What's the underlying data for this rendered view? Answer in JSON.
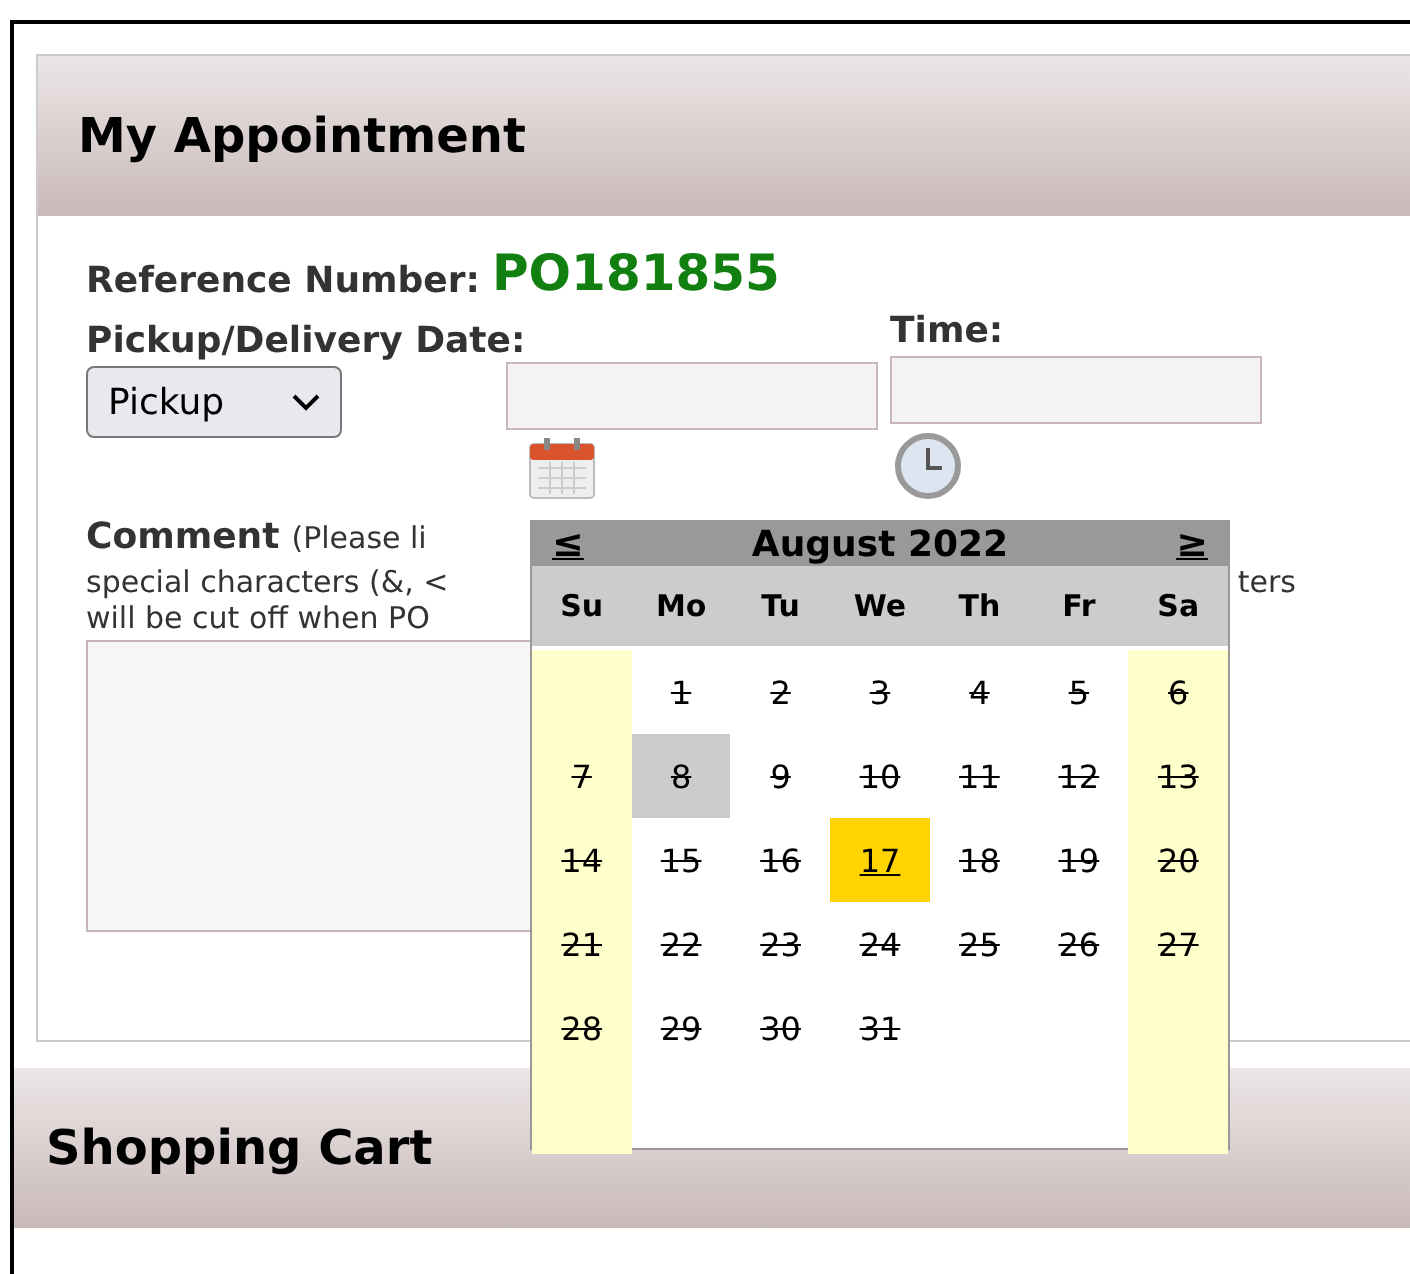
{
  "appointment": {
    "title": "My Appointment",
    "reference_label": "Reference Number:",
    "reference_number": "PO181855",
    "date_label": "Pickup/Delivery Date:",
    "time_label": "Time:",
    "type_select": {
      "value": "Pickup"
    },
    "comment": {
      "label": "Comment",
      "note_line_1": "(Please li",
      "note_line_2_left": "special characters (&, <",
      "note_line_2_right": "ters",
      "note_line_3": "will be cut off when PO"
    }
  },
  "datepicker": {
    "prev": "≤",
    "month": "August 2022",
    "next": "≥",
    "weekdays": [
      {
        "label": "Su",
        "weekend": true
      },
      {
        "label": "Mo",
        "weekend": false
      },
      {
        "label": "Tu",
        "weekend": false
      },
      {
        "label": "We",
        "weekend": false
      },
      {
        "label": "Th",
        "weekend": false
      },
      {
        "label": "Fr",
        "weekend": false
      },
      {
        "label": "Sa",
        "weekend": true
      }
    ],
    "weeks": [
      [
        {
          "day": "1",
          "disabled": true,
          "selected": false,
          "today": false
        },
        {
          "day": "2",
          "disabled": true,
          "selected": false,
          "today": false
        },
        {
          "day": "3",
          "disabled": true,
          "selected": false,
          "today": false
        },
        {
          "day": "4",
          "disabled": true,
          "selected": false,
          "today": false
        },
        {
          "day": "5",
          "disabled": true,
          "selected": false,
          "today": false
        },
        {
          "day": "6",
          "disabled": true,
          "selected": false,
          "today": false
        }
      ],
      [
        {
          "day": "7",
          "disabled": true,
          "selected": false,
          "today": false
        },
        {
          "day": "8",
          "disabled": true,
          "selected": false,
          "today": true
        },
        {
          "day": "9",
          "disabled": true,
          "selected": false,
          "today": false
        },
        {
          "day": "10",
          "disabled": true,
          "selected": false,
          "today": false
        },
        {
          "day": "11",
          "disabled": true,
          "selected": false,
          "today": false
        },
        {
          "day": "12",
          "disabled": true,
          "selected": false,
          "today": false
        },
        {
          "day": "13",
          "disabled": true,
          "selected": false,
          "today": false
        }
      ],
      [
        {
          "day": "14",
          "disabled": true,
          "selected": false,
          "today": false
        },
        {
          "day": "15",
          "disabled": true,
          "selected": false,
          "today": false
        },
        {
          "day": "16",
          "disabled": true,
          "selected": false,
          "today": false
        },
        {
          "day": "17",
          "disabled": false,
          "selected": true,
          "today": false
        },
        {
          "day": "18",
          "disabled": true,
          "selected": false,
          "today": false
        },
        {
          "day": "19",
          "disabled": true,
          "selected": false,
          "today": false
        },
        {
          "day": "20",
          "disabled": true,
          "selected": false,
          "today": false
        }
      ],
      [
        {
          "day": "21",
          "disabled": true,
          "selected": false,
          "today": false
        },
        {
          "day": "22",
          "disabled": true,
          "selected": false,
          "today": false
        },
        {
          "day": "23",
          "disabled": true,
          "selected": false,
          "today": false
        },
        {
          "day": "24",
          "disabled": true,
          "selected": false,
          "today": false
        },
        {
          "day": "25",
          "disabled": true,
          "selected": false,
          "today": false
        },
        {
          "day": "26",
          "disabled": true,
          "selected": false,
          "today": false
        },
        {
          "day": "27",
          "disabled": true,
          "selected": false,
          "today": false
        }
      ],
      [
        {
          "day": "28",
          "disabled": true,
          "selected": false,
          "today": false
        },
        {
          "day": "29",
          "disabled": true,
          "selected": false,
          "today": false
        },
        {
          "day": "30",
          "disabled": true,
          "selected": false,
          "today": false
        },
        {
          "day": "31",
          "disabled": true,
          "selected": false,
          "today": false
        }
      ]
    ]
  },
  "shopping_cart": {
    "title": "Shopping Cart"
  }
}
